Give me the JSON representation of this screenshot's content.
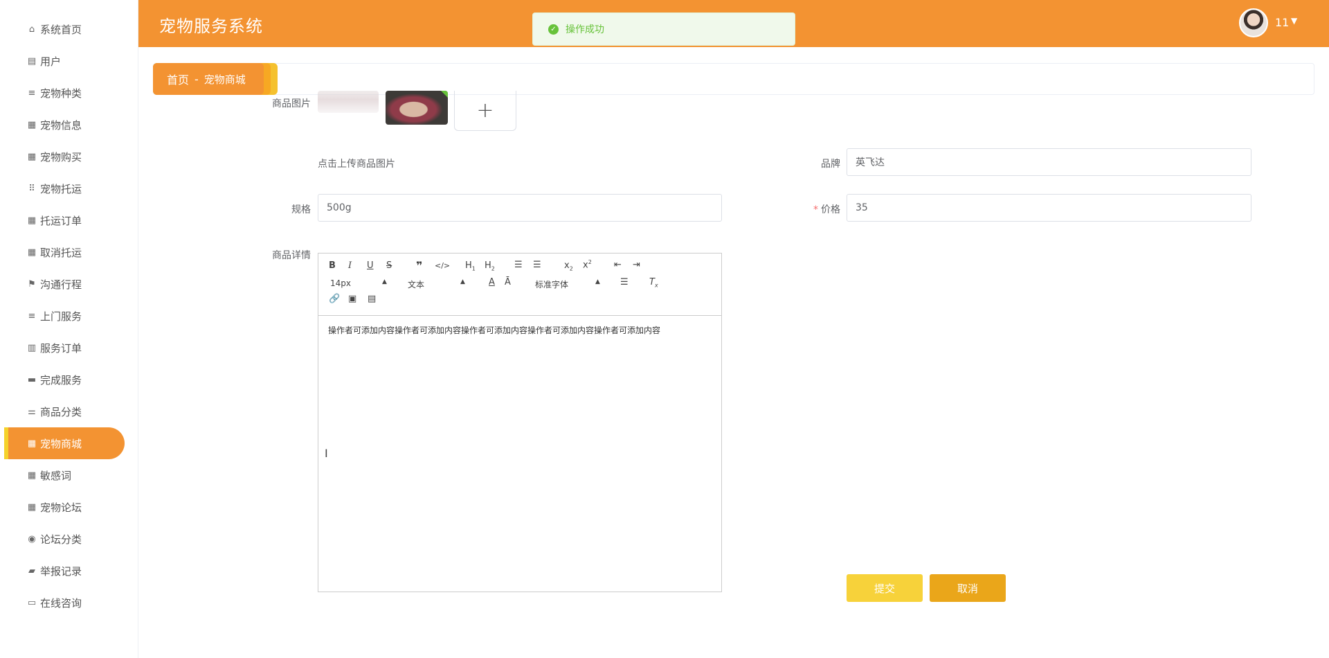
{
  "app": {
    "title": "宠物服务系统"
  },
  "user": {
    "name": "11"
  },
  "toast": {
    "message": "操作成功"
  },
  "breadcrumb": {
    "home": "首页",
    "separator": "-",
    "current": "宠物商城"
  },
  "sidebar": {
    "items": [
      {
        "label": "系统首页",
        "icon": "home-icon"
      },
      {
        "label": "用户",
        "icon": "clipboard-icon"
      },
      {
        "label": "宠物种类",
        "icon": "list-icon"
      },
      {
        "label": "宠物信息",
        "icon": "grid-icon"
      },
      {
        "label": "宠物购买",
        "icon": "grid-icon"
      },
      {
        "label": "宠物托运",
        "icon": "grid-dots-icon"
      },
      {
        "label": "托运订单",
        "icon": "grid-icon"
      },
      {
        "label": "取消托运",
        "icon": "grid-icon"
      },
      {
        "label": "沟通行程",
        "icon": "flag-icon"
      },
      {
        "label": "上门服务",
        "icon": "list-icon"
      },
      {
        "label": "服务订单",
        "icon": "bar-icon"
      },
      {
        "label": "完成服务",
        "icon": "chat-icon"
      },
      {
        "label": "商品分类",
        "icon": "sliders-icon"
      },
      {
        "label": "宠物商城",
        "icon": "grid-icon",
        "active": true
      },
      {
        "label": "敏感词",
        "icon": "grid-icon"
      },
      {
        "label": "宠物论坛",
        "icon": "grid-icon"
      },
      {
        "label": "论坛分类",
        "icon": "location-icon"
      },
      {
        "label": "举报记录",
        "icon": "ticket-icon"
      },
      {
        "label": "在线咨询",
        "icon": "briefcase-icon"
      }
    ]
  },
  "form": {
    "image_label": "商品图片",
    "upload_hint": "点击上传商品图片",
    "brand_label": "品牌",
    "brand_value": "英飞达",
    "spec_label": "规格",
    "spec_value": "500g",
    "price_label": "价格",
    "price_value": "35",
    "detail_label": "商品详情"
  },
  "editor": {
    "font_size": "14px",
    "format": "文本",
    "font_family": "标准字体",
    "content": "操作者可添加内容操作者可添加内容操作者可添加内容操作者可添加内容操作者可添加内容"
  },
  "actions": {
    "submit": "提交",
    "cancel": "取消"
  }
}
